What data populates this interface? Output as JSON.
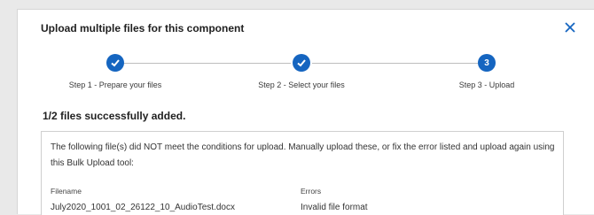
{
  "dialog": {
    "title": "Upload multiple files for this component",
    "close_glyph": "✕"
  },
  "steps": [
    {
      "number": "1",
      "label": "Step 1 - Prepare your files",
      "state": "complete",
      "icon": "check-icon"
    },
    {
      "number": "2",
      "label": "Step 2 - Select your files",
      "state": "complete",
      "icon": "check-icon"
    },
    {
      "number": "3",
      "label": "Step 3 - Upload",
      "state": "current"
    }
  ],
  "summary": "1/2 files successfully added.",
  "error_panel": {
    "message": "The following file(s) did NOT meet the conditions for upload. Manually upload these, or fix the error listed and upload again using this Bulk Upload tool:",
    "columns": {
      "filename": "Filename",
      "errors": "Errors"
    },
    "rows": [
      {
        "filename": "July2020_1001_02_26122_10_AudioTest.docx",
        "error": "Invalid file format"
      }
    ]
  },
  "colors": {
    "accent": "#1565c0",
    "track": "#bdbdbd"
  }
}
